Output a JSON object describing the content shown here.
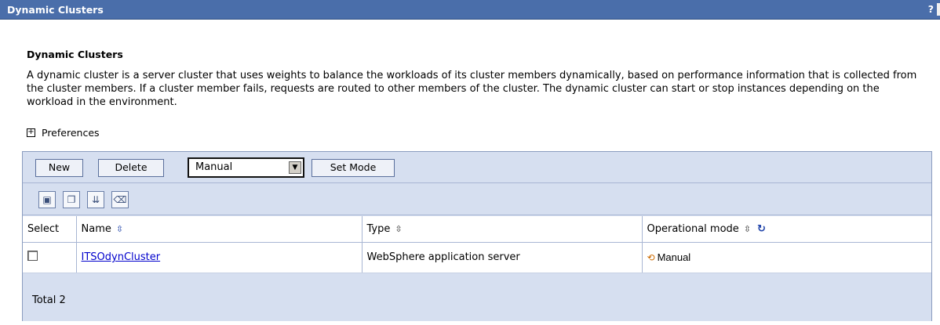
{
  "window": {
    "title": "Dynamic Clusters",
    "help_label": "?"
  },
  "section": {
    "heading": "Dynamic Clusters",
    "description": "A dynamic cluster is a server cluster that uses weights to balance the workloads of its cluster members dynamically, based on performance information that is collected from the cluster members. If a cluster member fails, requests are routed to other members of the cluster. The dynamic cluster can start or stop instances depending on the workload in the environment."
  },
  "preferences": {
    "toggle": "+",
    "label": "Preferences"
  },
  "toolbar": {
    "new_label": "New",
    "delete_label": "Delete",
    "mode_select_value": "Manual",
    "set_mode_label": "Set Mode",
    "icons": [
      "select-all-icon",
      "deselect-all-icon",
      "show-filter-icon",
      "clear-filter-icon"
    ]
  },
  "table": {
    "columns": {
      "select": "Select",
      "name": "Name",
      "type": "Type",
      "mode": "Operational mode"
    },
    "sort_glyph": "⇳",
    "refresh_glyph": "↻",
    "rows": [
      {
        "name": "ITSOdynCluster",
        "type": "WebSphere application server",
        "mode": "Manual"
      }
    ],
    "total": "Total 2"
  },
  "colors": {
    "titlebar": "#4a6eaa",
    "panel": "#d6dff0",
    "link": "#0000cc"
  }
}
